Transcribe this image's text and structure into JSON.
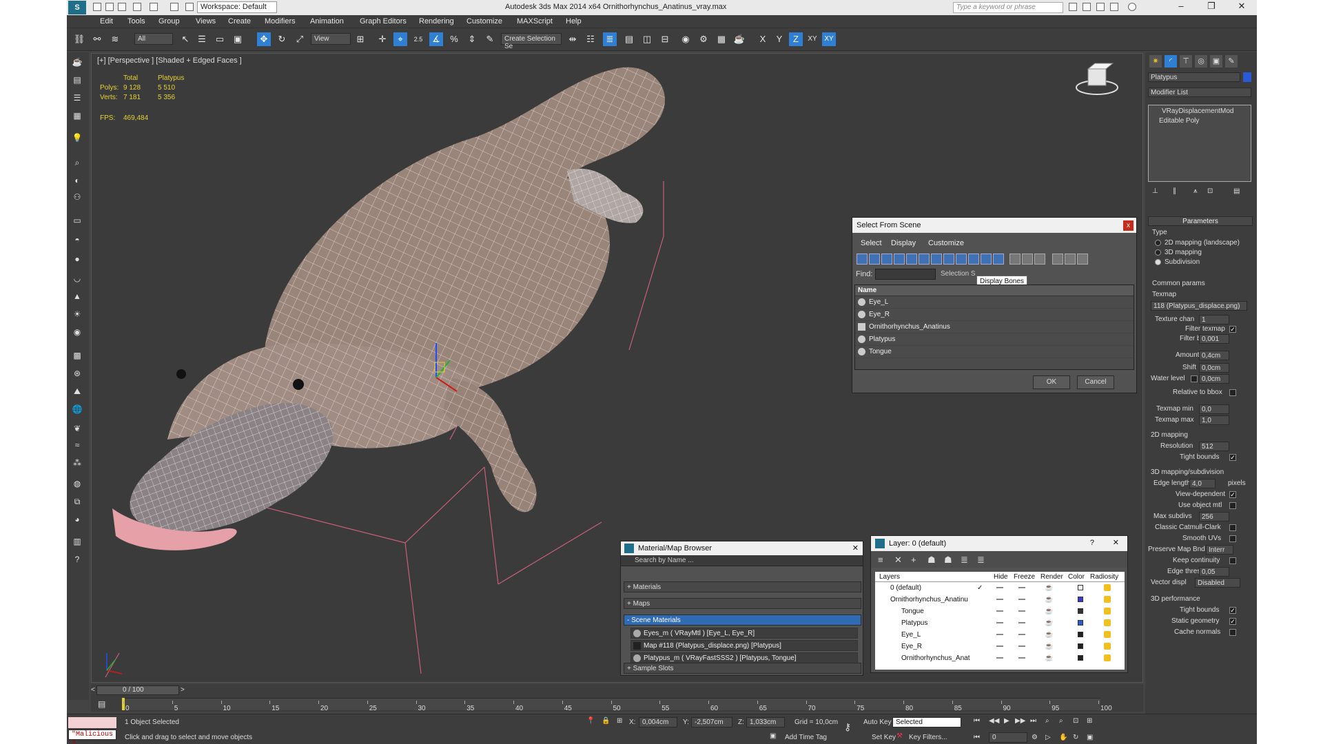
{
  "title_bar": {
    "workspace": "Workspace: Default",
    "app_title": "Autodesk 3ds Max  2014 x64     Ornithorhynchus_Anatinus_vray.max",
    "search_placeholder": "Type a keyword or phrase"
  },
  "menu": [
    "Edit",
    "Tools",
    "Group",
    "Views",
    "Create",
    "Modifiers",
    "Animation",
    "Graph Editors",
    "Rendering",
    "Customize",
    "MAXScript",
    "Help"
  ],
  "toolbar": {
    "selection_filter": "All",
    "ref_coord": "View",
    "snap_angle_label": "2.5",
    "create_selection_set": "Create Selection Se",
    "axis_labels": [
      "X",
      "Y",
      "Z",
      "XY",
      "XY"
    ]
  },
  "viewport": {
    "label": "[+] [Perspective ] [Shaded + Edged Faces ]",
    "stats": {
      "col_total": "Total",
      "col_object": "Platypus",
      "polys_label": "Polys:",
      "polys_total": "9 128",
      "polys_obj": "5 510",
      "verts_label": "Verts:",
      "verts_total": "7 181",
      "verts_obj": "5 356",
      "fps_label": "FPS:",
      "fps_value": "469,484"
    }
  },
  "select_from_scene": {
    "title": "Select From Scene",
    "close": "x",
    "menu": [
      "Select",
      "Display",
      "Customize"
    ],
    "find_label": "Find:",
    "selection_set_label": "Selection S",
    "tooltip": "Display Bones",
    "column": "Name",
    "items": [
      "Eye_L",
      "Eye_R",
      "Ornithorhynchus_Anatinus",
      "Platypus",
      "Tongue"
    ],
    "ok": "OK",
    "cancel": "Cancel"
  },
  "material_browser": {
    "title": "Material/Map Browser",
    "search_placeholder": "Search by Name ...",
    "categories": [
      "+ Materials",
      "+ Maps",
      "- Scene Materials",
      "+ Sample Slots"
    ],
    "scene_materials": [
      "Eyes_m  ( VRayMtl ) [Eye_L, Eye_R]",
      "Map #118 (Platypus_displace.png) [Platypus]",
      "Platypus_m  ( VRayFastSSS2 ) [Platypus, Tongue]"
    ]
  },
  "layer_explorer": {
    "title": "Layer: 0 (default)",
    "help": "?",
    "columns": [
      "Layers",
      "Hide",
      "Freeze",
      "Render",
      "Color",
      "Radiosity"
    ],
    "rows": [
      {
        "name": "0 (default)",
        "color": "#ffffff"
      },
      {
        "name": "Ornithorhynchus_Anatinu",
        "color": "#3a3ad0"
      },
      {
        "name": "Tongue",
        "color": "#333333"
      },
      {
        "name": "Platypus",
        "color": "#2a5ad8"
      },
      {
        "name": "Eye_L",
        "color": "#222222"
      },
      {
        "name": "Eye_R",
        "color": "#222222"
      },
      {
        "name": "Ornithorhynchus_Anat",
        "color": "#222222"
      }
    ]
  },
  "command_panel": {
    "object_name": "Platypus",
    "modifier_list": "Modifier List",
    "stack": [
      "VRayDisplacementMod",
      "Editable Poly"
    ],
    "rollout_parameters": "Parameters",
    "type_label": "Type",
    "type_options": [
      "2D mapping (landscape)",
      "3D mapping",
      "Subdivision"
    ],
    "common_params": "Common params",
    "texmap_label": "Texmap",
    "texmap_value": "118 (Platypus_displace.png)",
    "texture_chan_label": "Texture chan",
    "texture_chan_value": "1",
    "filter_texmap_label": "Filter texmap",
    "filter_blur_label": "Filter blur",
    "filter_blur_value": "0,001",
    "amount_label": "Amount",
    "amount_value": "0,4cm",
    "shift_label": "Shift",
    "shift_value": "0,0cm",
    "water_level_label": "Water level",
    "water_level_value": "0,0cm",
    "relative_bbox_label": "Relative to bbox",
    "texmap_min_label": "Texmap min",
    "texmap_min_value": "0,0",
    "texmap_max_label": "Texmap max",
    "texmap_max_value": "1,0",
    "section_2d": "2D mapping",
    "resolution_label": "Resolution",
    "resolution_value": "512",
    "tight_bounds_label": "Tight bounds",
    "section_3d": "3D mapping/subdivision",
    "edge_length_label": "Edge length",
    "edge_length_value": "4,0",
    "pixels_label": "pixels",
    "view_dependent_label": "View-dependent",
    "use_object_mtl_label": "Use object mtl",
    "max_subdivs_label": "Max subdivs",
    "max_subdivs_value": "256",
    "classic_label": "Classic Catmull-Clark",
    "smooth_uvs_label": "Smooth UVs",
    "preserve_label": "Preserve Map Bnd",
    "preserve_value": "Interr",
    "keep_continuity_label": "Keep continuity",
    "edge_thresh_label": "Edge thresh",
    "edge_thresh_value": "0,05",
    "vector_displ_label": "Vector displ",
    "vector_displ_value": "Disabled",
    "section_perf": "3D performance",
    "perf_tight_bounds": "Tight bounds",
    "static_geometry_label": "Static geometry",
    "cache_normals_label": "Cache normals"
  },
  "timeline": {
    "frame_counter": "0 / 100",
    "ticks": [
      "0",
      "5",
      "10",
      "15",
      "20",
      "25",
      "30",
      "35",
      "40",
      "45",
      "50",
      "55",
      "60",
      "65",
      "70",
      "75",
      "80",
      "85",
      "90",
      "95",
      "100"
    ]
  },
  "status_bar": {
    "script_listener": "\"Malicious s",
    "selection_info": "1 Object Selected",
    "prompt": "Click and drag to select and move objects",
    "x_label": "X:",
    "x_value": "0,004cm",
    "y_label": "Y:",
    "y_value": "-2,507cm",
    "z_label": "Z:",
    "z_value": "1,033cm",
    "grid": "Grid = 10,0cm",
    "add_time_tag": "Add Time Tag",
    "auto_key": "Auto Key",
    "auto_key_mode": "Selected",
    "set_key": "Set Key",
    "key_filters": "Key Filters...",
    "frame": "0"
  },
  "colors": {
    "accent": "#2f7fd5",
    "panel_bg": "#3d3d3d",
    "viewport_bg": "#3b3b3b",
    "stats_text": "#e6d234",
    "close_red": "#c42b1c"
  }
}
